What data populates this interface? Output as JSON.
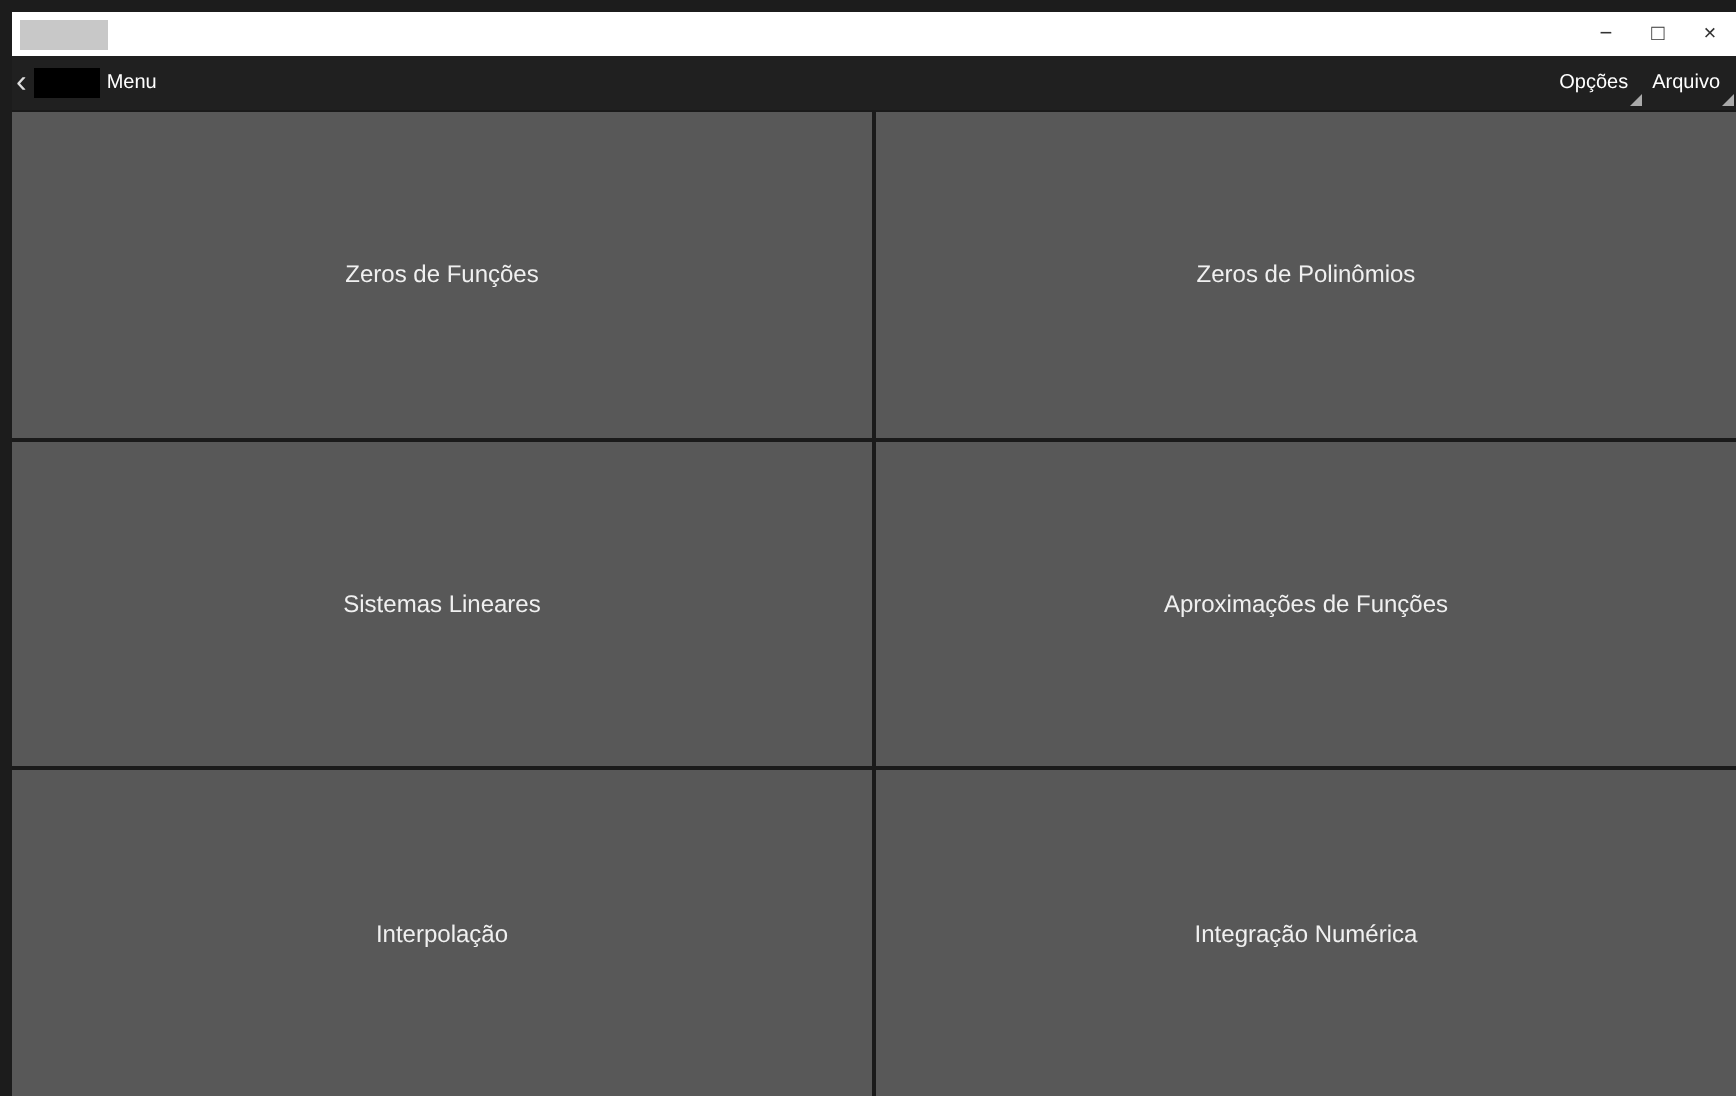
{
  "window": {
    "controls": [
      "−",
      "□",
      "×"
    ]
  },
  "nav": {
    "back": "‹",
    "title": "Menu",
    "menus": [
      {
        "label": "Opções"
      },
      {
        "label": "Arquivo"
      }
    ]
  },
  "tiles": [
    {
      "label": "Zeros de Funções"
    },
    {
      "label": "Zeros de Polinômios"
    },
    {
      "label": "Sistemas Lineares"
    },
    {
      "label": "Aproximações de Funções"
    },
    {
      "label": "Interpolação"
    },
    {
      "label": "Integração Numérica"
    }
  ]
}
